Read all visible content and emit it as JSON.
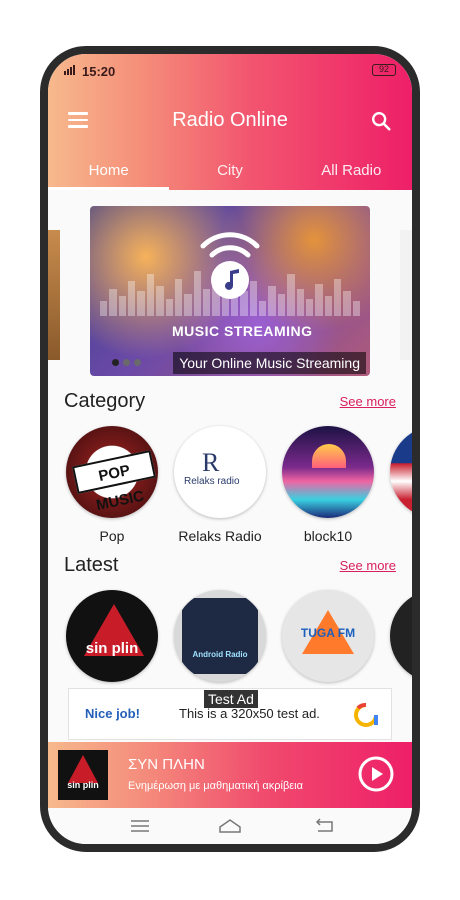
{
  "status_bar": {
    "time": "15:20",
    "battery": "92"
  },
  "header": {
    "title": "Radio Online"
  },
  "tabs": [
    {
      "label": "Home",
      "active": true
    },
    {
      "label": "City",
      "active": false
    },
    {
      "label": "All Radio",
      "active": false
    }
  ],
  "banner": {
    "headline": "MUSIC STREAMING",
    "caption": "Your Online Music Streaming",
    "slides": 3,
    "current_slide": 1
  },
  "category": {
    "title": "Category",
    "see_more": "See more",
    "items": [
      {
        "label": "Pop",
        "logo_text": "POP MUSIC"
      },
      {
        "label": "Relaks Radio",
        "logo_text": "Relaks radio"
      },
      {
        "label": "block10"
      }
    ]
  },
  "latest": {
    "title": "Latest",
    "see_more": "See more",
    "items": [
      {
        "logo_text": "sin plin"
      },
      {
        "logo_text": "Android Radio"
      },
      {
        "logo_text": "TUGA FM"
      }
    ]
  },
  "ad": {
    "tag": "Test Ad",
    "nice": "Nice job!",
    "message": "This is a 320x50 test ad."
  },
  "player": {
    "station": "ΣΥΝ ΠΛΗΝ",
    "description": "Ενημέρωση με μαθηματική ακρίβεια",
    "thumb_text": "sin plin"
  },
  "colors": {
    "accent": "#ee1f68",
    "gradient_start": "#f7b98c",
    "link": "#d81f5f"
  },
  "icons": [
    "menu-icon",
    "search-icon",
    "music-note-icon",
    "play-icon",
    "nav-menu-icon",
    "nav-home-icon",
    "nav-back-icon"
  ]
}
